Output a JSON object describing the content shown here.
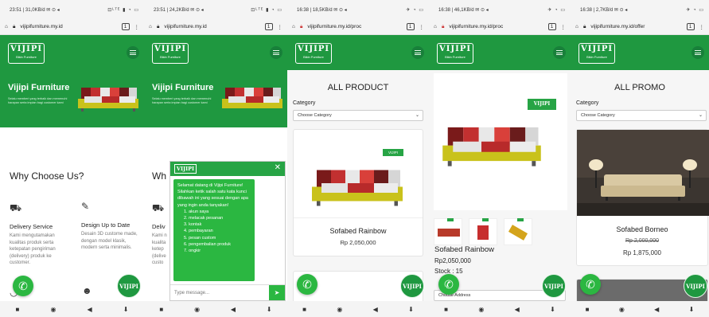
{
  "brand": {
    "logo_text": "VIJIPI",
    "logo_tagline": "Bikin Furniture",
    "green": "#1f9840"
  },
  "phones": [
    {
      "status_left": "23:51 | 31,0KB/d ✉ ⊙ ◂",
      "status_right": "⊡ᴸᵀᴱ ▮ ◔ ▭",
      "url": "vijipifurniture.my.id",
      "tabs": "1",
      "hero_title": "Vijipi Furniture",
      "hero_sub": "Selalu memberi yang terbaik dan memenuhi harapan serta impian bagi customer kami",
      "section_title": "Why Choose Us?",
      "features": [
        {
          "icon": "truck-icon",
          "title": "Delivery Service",
          "text": "Kami mengutamakan kualitas produk serta ketepatan pengiriman (delivery) produk ke customer."
        },
        {
          "icon": "design-icon",
          "title": "Design Up to Date",
          "text": "Desain 3D custome made, dengan model klasik, modern serta minimalis."
        }
      ]
    },
    {
      "status_left": "23:51 | 24,2KB/d ✉ ⊙ ◂",
      "status_right": "⊡ᴸᵀᴱ ▮ ◔ ▭",
      "url": "vijipifurniture.my.id",
      "tabs": "1",
      "hero_title": "Vijipi Furniture",
      "section_title_partial": "Wh",
      "feature_partial": "Deliv",
      "feature_partial_text": "Kami n kualita ketep (delive custo",
      "chat": {
        "logo": "VIJIPI",
        "lines": [
          "Selamat datang di Vijipi Furniture! Silahkan ketik salah satu kata kunci dibawah ini yang sesuai dengan apa yang ingin anda tanyakan!",
          "1. akun saya",
          "2. melacak pesanan",
          "3. kontak",
          "4. pembayaran",
          "5. pesan custom",
          "6. pengembalian produk",
          "7. ongkir"
        ],
        "placeholder": "Type message..."
      }
    },
    {
      "status_left": "16:38 | 18,5KB/d ✉ ⊙ ◂",
      "status_right": "✈ ◔ ▭",
      "url": "vijipifurniture.my.id/proc",
      "tabs": "1",
      "page_title": "ALL PRODUCT",
      "category_label": "Category",
      "category_value": "Choose Category",
      "product": {
        "name": "Sofabed Rainbow",
        "price": "Rp 2,050,000"
      }
    },
    {
      "status_left": "16:38 | 46,1KB/d ✉ ⊙ ◂",
      "status_right": "✈ ◔ ▭",
      "url": "vijipifurniture.my.id/proc",
      "tabs": "1",
      "product": {
        "name": "Sofabed Rainbow",
        "price": "Rp2,050,000",
        "stock": "Stock : 15"
      },
      "address_placeholder": "Choose Address"
    },
    {
      "status_left": "16:38 | 2,7KB/d ✉ ⊙ ◂",
      "status_right": "✈ ◔ ▭",
      "url": "vijipifurniture.my.id/offer",
      "tabs": "1",
      "page_title": "ALL PROMO",
      "category_label": "Category",
      "category_value": "Choose Category",
      "product": {
        "name": "Sofabed Borneo",
        "old_price": "Rp 2,000,000",
        "price": "Rp 1,875,000"
      }
    }
  ],
  "nav": {
    "home": "■",
    "circle": "◉",
    "back": "◀",
    "down": "⬇"
  },
  "vbtn_label": "VIJIPI"
}
